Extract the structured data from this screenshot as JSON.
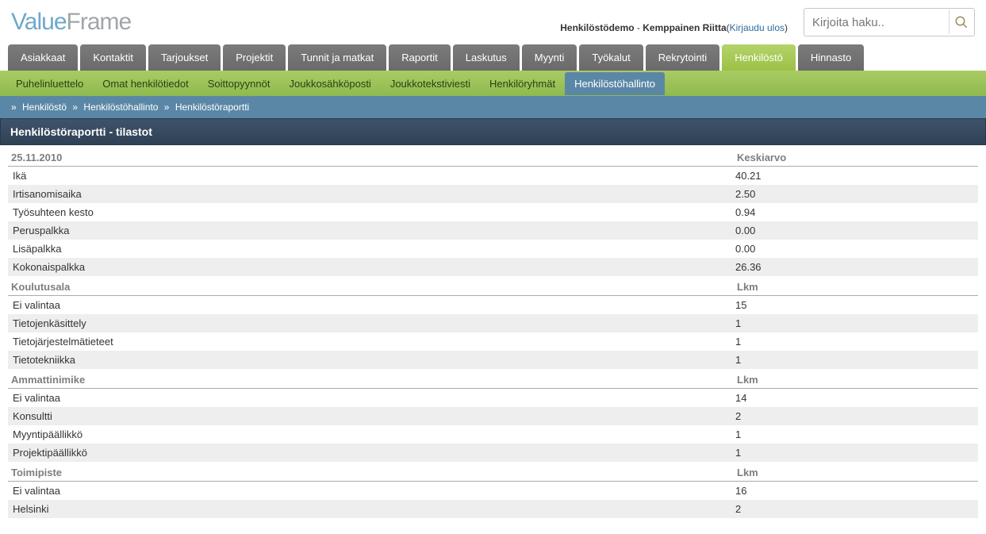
{
  "logo": {
    "part1": "Value",
    "part2": "Frame"
  },
  "header": {
    "system": "Henkilöstödemo",
    "user": "Kemppainen Riitta",
    "logout": "Kirjaudu ulos"
  },
  "search": {
    "placeholder": "Kirjoita haku.."
  },
  "main_tabs": [
    {
      "label": "Asiakkaat"
    },
    {
      "label": "Kontaktit"
    },
    {
      "label": "Tarjoukset"
    },
    {
      "label": "Projektit"
    },
    {
      "label": "Tunnit ja matkat"
    },
    {
      "label": "Raportit"
    },
    {
      "label": "Laskutus"
    },
    {
      "label": "Myynti"
    },
    {
      "label": "Työkalut"
    },
    {
      "label": "Rekrytointi"
    },
    {
      "label": "Henkilöstö",
      "active": true
    },
    {
      "label": "Hinnasto"
    }
  ],
  "sub_tabs": [
    {
      "label": "Puhelinluettelo"
    },
    {
      "label": "Omat henkilötiedot"
    },
    {
      "label": "Soittopyynnöt"
    },
    {
      "label": "Joukkosähköposti"
    },
    {
      "label": "Joukkotekstiviesti"
    },
    {
      "label": "Henkilöryhmät"
    },
    {
      "label": "Henkilöstöhallinto",
      "active": true
    }
  ],
  "breadcrumb": [
    "Henkilöstö",
    "Henkilöstöhallinto",
    "Henkilöstöraportti"
  ],
  "title": "Henkilöstöraportti - tilastot",
  "groups": [
    {
      "head_left": "25.11.2010",
      "head_right": "Keskiarvo",
      "rows": [
        {
          "l": "Ikä",
          "r": "40.21"
        },
        {
          "l": "Irtisanomisaika",
          "r": "2.50"
        },
        {
          "l": "Työsuhteen kesto",
          "r": "0.94"
        },
        {
          "l": "Peruspalkka",
          "r": "0.00"
        },
        {
          "l": "Lisäpalkka",
          "r": "0.00"
        },
        {
          "l": "Kokonaispalkka",
          "r": "26.36"
        }
      ]
    },
    {
      "head_left": "Koulutusala",
      "head_right": "Lkm",
      "rows": [
        {
          "l": "Ei valintaa",
          "r": "15"
        },
        {
          "l": "Tietojenkäsittely",
          "r": "1"
        },
        {
          "l": "Tietojärjestelmätieteet",
          "r": "1"
        },
        {
          "l": "Tietotekniikka",
          "r": "1"
        }
      ]
    },
    {
      "head_left": "Ammattinimike",
      "head_right": "Lkm",
      "rows": [
        {
          "l": "Ei valintaa",
          "r": "14"
        },
        {
          "l": "Konsultti",
          "r": "2"
        },
        {
          "l": "Myyntipäällikkö",
          "r": "1"
        },
        {
          "l": "Projektipäällikkö",
          "r": "1"
        }
      ]
    },
    {
      "head_left": "Toimipiste",
      "head_right": "Lkm",
      "rows": [
        {
          "l": "Ei valintaa",
          "r": "16"
        },
        {
          "l": "Helsinki",
          "r": "2"
        }
      ]
    }
  ]
}
